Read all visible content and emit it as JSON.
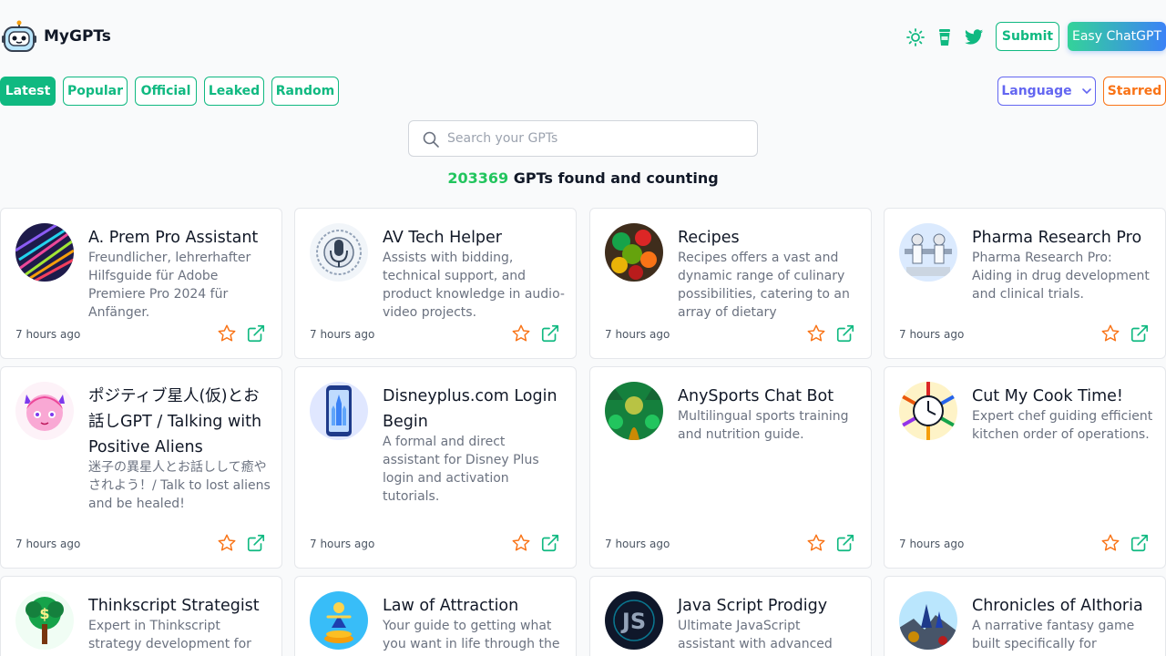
{
  "header": {
    "brand": "MyGPTs",
    "submit_label": "Submit",
    "easy_label": "Easy ChatGPT",
    "icons": [
      "sun-icon",
      "coffee-cup-icon",
      "twitter-icon"
    ]
  },
  "tabs": [
    "Latest",
    "Popular",
    "Official",
    "Leaked",
    "Random"
  ],
  "language_label": "Language",
  "starred_label": "Starred",
  "search": {
    "placeholder": "Search your GPTs"
  },
  "count": {
    "number": "203369",
    "suffix": " GPTs found and counting"
  },
  "colors": {
    "green": "#10b981",
    "indigo": "#6366f1",
    "orange": "#f97316"
  },
  "cards": [
    {
      "title": "A. Prem Pro Assistant",
      "desc": "Freundlicher, lehrerhafter Hilfsguide für Adobe Premiere Pro 2024 für Anfänger.",
      "time": "7 hours ago"
    },
    {
      "title": "AV Tech Helper",
      "desc": "Assists with bidding, technical support, and product knowledge in audio-video projects.",
      "time": "7 hours ago"
    },
    {
      "title": "Recipes",
      "desc": "Recipes offers a vast and dynamic range of culinary possibilities, catering to an array of dietary preferences,",
      "time": "7 hours ago"
    },
    {
      "title": "Pharma Research Pro",
      "desc": "Pharma Research Pro: Aiding in drug development and clinical trials.",
      "time": "7 hours ago"
    },
    {
      "title": "ポジティブ星人(仮)とお話しGPT / Talking with Positive Aliens",
      "desc": "迷子の異星人とお話しして癒やされよう！/ Talk to lost aliens and be healed!",
      "time": "7 hours ago"
    },
    {
      "title": "Disneyplus.com Login Begin",
      "desc": "A formal and direct assistant for Disney Plus login and activation tutorials.",
      "time": "7 hours ago"
    },
    {
      "title": "AnySports Chat Bot",
      "desc": "Multilingual sports training and nutrition guide.",
      "time": "7 hours ago"
    },
    {
      "title": "Cut My Cook Time!",
      "desc": "Expert chef guiding efficient kitchen order of operations.",
      "time": "7 hours ago"
    },
    {
      "title": "Thinkscript Strategist",
      "desc": "Expert in Thinkscript strategy development for various",
      "time": ""
    },
    {
      "title": "Law of Attraction",
      "desc": "Your guide to getting what you want in life through the",
      "time": ""
    },
    {
      "title": "Java Script Prodigy",
      "desc": "Ultimate JavaScript assistant with advanced knowledge and",
      "time": ""
    },
    {
      "title": "Chronicles of AIthoria",
      "desc": "A narrative fantasy game built specifically for ChatGPT",
      "time": ""
    }
  ]
}
